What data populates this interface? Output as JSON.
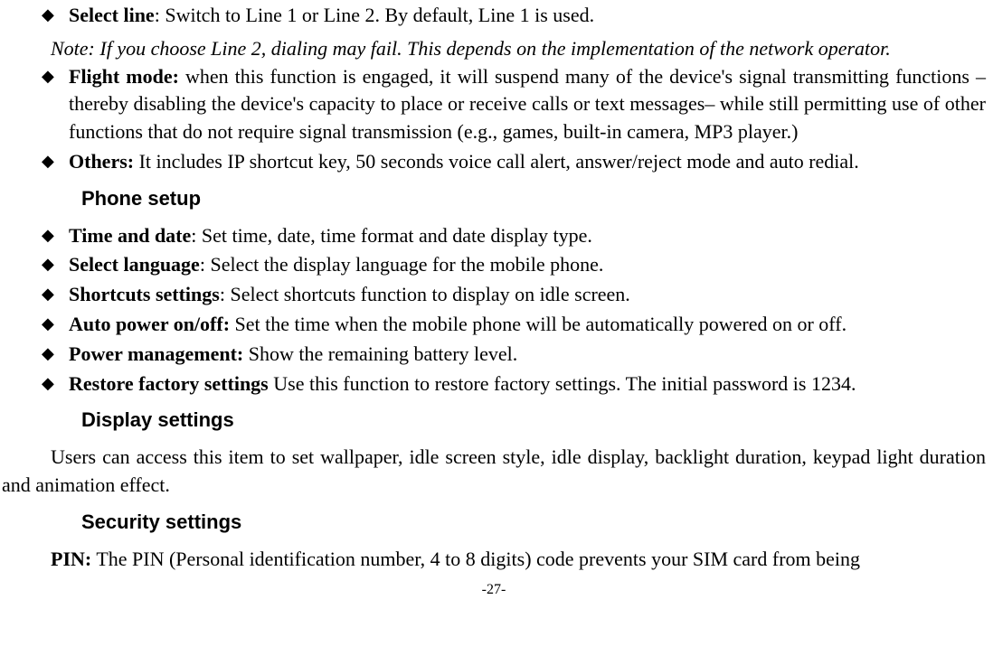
{
  "top_list": [
    {
      "label": "Select line",
      "sep": ": ",
      "text": "Switch to Line 1 or Line 2. By default, Line 1 is used."
    }
  ],
  "note": "Note: If you choose Line 2, dialing may fail. This depends on the implementation of the network operator.",
  "top_list2": [
    {
      "label": "Flight mode:",
      "sep": " ",
      "text": "when this function is engaged, it will suspend many of the device's signal transmitting functions – thereby disabling the device's capacity to place or receive calls or text messages– while still permitting use of other functions that do not require signal transmission (e.g., games, built-in camera, MP3 player.)"
    },
    {
      "label": "Others:",
      "sep": " ",
      "text": "It includes IP shortcut key, 50 seconds voice call alert, answer/reject mode and auto redial."
    }
  ],
  "headings": {
    "phone_setup": "Phone setup",
    "display_settings": "Display settings",
    "security_settings": "Security settings"
  },
  "phone_setup_list": [
    {
      "label": "Time and date",
      "sep": ": ",
      "text": "Set time, date, time format and date display type."
    },
    {
      "label": "Select language",
      "sep": ": ",
      "text": "Select the display language for the mobile phone."
    },
    {
      "label": "Shortcuts settings",
      "sep": ": ",
      "text": "Select shortcuts function to display on idle screen."
    },
    {
      "label": "Auto power on/off:",
      "sep": " ",
      "text": "Set the time when the mobile phone will be automatically powered on or off."
    },
    {
      "label": "Power management:",
      "sep": " ",
      "text": "Show the remaining battery level."
    },
    {
      "label": "Restore factory settings",
      "sep": " ",
      "text": "Use this function to restore factory settings. The initial password is 1234."
    }
  ],
  "display_para": "Users can access this item to set wallpaper, idle screen style, idle display, backlight duration, keypad light duration and animation effect.",
  "pin_label": "PIN:",
  "pin_text": " The PIN (Personal identification number, 4 to 8 digits) code prevents your SIM card from being",
  "page_number": "-27-"
}
